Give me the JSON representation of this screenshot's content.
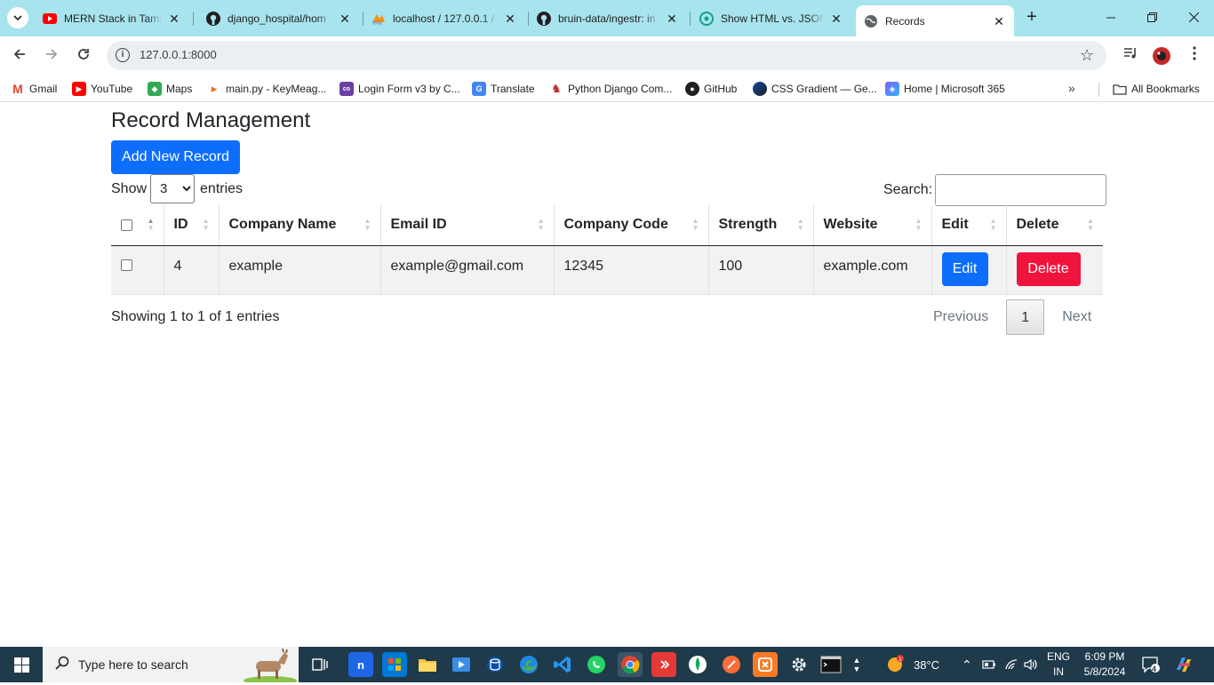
{
  "browser": {
    "tabs": [
      {
        "title": "MERN Stack in Tamil",
        "icon": "youtube-icon",
        "color": "#ff0000"
      },
      {
        "title": "django_hospital/hom",
        "icon": "github-icon",
        "color": "#1f1f1f"
      },
      {
        "title": "localhost / 127.0.0.1 /",
        "icon": "phpmyadmin-icon",
        "color": "#f29111"
      },
      {
        "title": "bruin-data/ingestr: in",
        "icon": "github-icon",
        "color": "#1f1f1f"
      },
      {
        "title": "Show HTML vs. JSON",
        "icon": "chatgpt-icon",
        "color": "#10a37f"
      },
      {
        "title": "Records",
        "icon": "globe-icon",
        "color": "#5f6368"
      }
    ],
    "url": "127.0.0.1:8000",
    "bookmarks": [
      {
        "label": "Gmail",
        "color": "#ea4335",
        "glyph": "M"
      },
      {
        "label": "YouTube",
        "color": "#ff0000",
        "glyph": "▶"
      },
      {
        "label": "Maps",
        "color": "#34a853",
        "glyph": "◆"
      },
      {
        "label": "main.py - KeyMeag...",
        "color": "#f26b1d",
        "glyph": "▸"
      },
      {
        "label": "Login Form v3 by C...",
        "color": "#6b3fa0",
        "glyph": "co"
      },
      {
        "label": "Translate",
        "color": "#4285f4",
        "glyph": "G"
      },
      {
        "label": "Python Django Com...",
        "color": "#c62828",
        "glyph": "♞"
      },
      {
        "label": "GitHub",
        "color": "#1f1f1f",
        "glyph": "●"
      },
      {
        "label": "CSS Gradient — Ge...",
        "color": "#0d47a1",
        "glyph": "●"
      },
      {
        "label": "Home | Microsoft 365",
        "color": "#7b61ff",
        "glyph": "◈"
      }
    ],
    "all_bookmarks": "All Bookmarks"
  },
  "page": {
    "title": "Record Management",
    "add_button": "Add New Record",
    "show_label": "Show",
    "entries_label": "entries",
    "entries_value": "3",
    "search_label": "Search:",
    "columns": [
      "",
      "ID",
      "Company Name",
      "Email ID",
      "Company Code",
      "Strength",
      "Website",
      "Edit",
      "Delete"
    ],
    "rows": [
      {
        "id": "4",
        "company_name": "example",
        "email": "example@gmail.com",
        "company_code": "12345",
        "strength": "100",
        "website": "example.com",
        "edit": "Edit",
        "delete": "Delete"
      }
    ],
    "info": "Showing 1 to 1 of 1 entries",
    "pager": {
      "previous": "Previous",
      "current": "1",
      "next": "Next"
    },
    "colors": {
      "primary": "#0d6efd",
      "danger": "#f0143c"
    }
  },
  "taskbar": {
    "search_placeholder": "Type here to search",
    "weather": "38°C",
    "lang_1": "ENG",
    "lang_2": "IN",
    "time": "6:09 PM",
    "date": "5/8/2024",
    "notifications": "4"
  }
}
